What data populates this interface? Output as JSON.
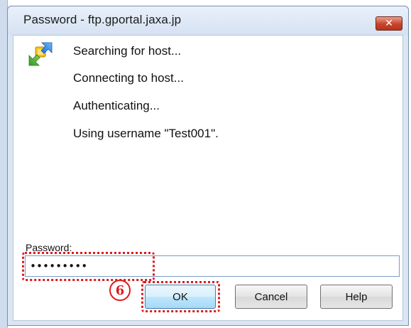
{
  "window": {
    "title": "Password - ftp.gportal.jaxa.jp",
    "close_symbol": "✕"
  },
  "icons": {
    "app": "transfer-arrows-icon",
    "close": "close-icon"
  },
  "status": {
    "lines": [
      "Searching for host...",
      "Connecting to host...",
      "Authenticating...",
      "Using username  \"Test001\"."
    ]
  },
  "form": {
    "password_label": "Password:",
    "password_value": "•••••••••"
  },
  "buttons": {
    "ok": "OK",
    "cancel": "Cancel",
    "help": "Help"
  },
  "annotation": {
    "step_number": "6"
  },
  "colors": {
    "highlight": "#e0181c",
    "close_button": "#c8432b",
    "titlebar": "#dbe6f4"
  }
}
